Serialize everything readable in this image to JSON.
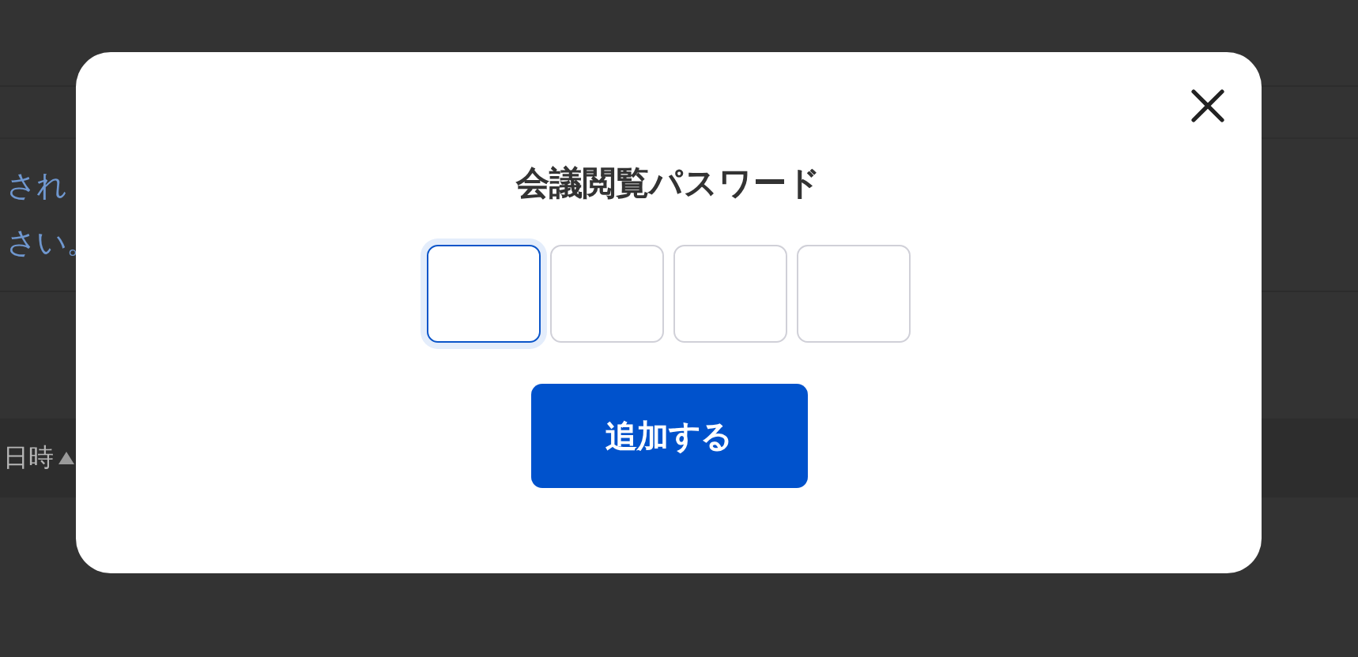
{
  "background": {
    "notice_lines": [
      "され",
      "さい。"
    ],
    "table_header": {
      "column_1": "日時"
    }
  },
  "dialog": {
    "title": "会議閲覧パスワード",
    "code_boxes": [
      {
        "focused": true
      },
      {
        "focused": false
      },
      {
        "focused": false
      },
      {
        "focused": false
      }
    ],
    "submit_button": "追加する"
  }
}
